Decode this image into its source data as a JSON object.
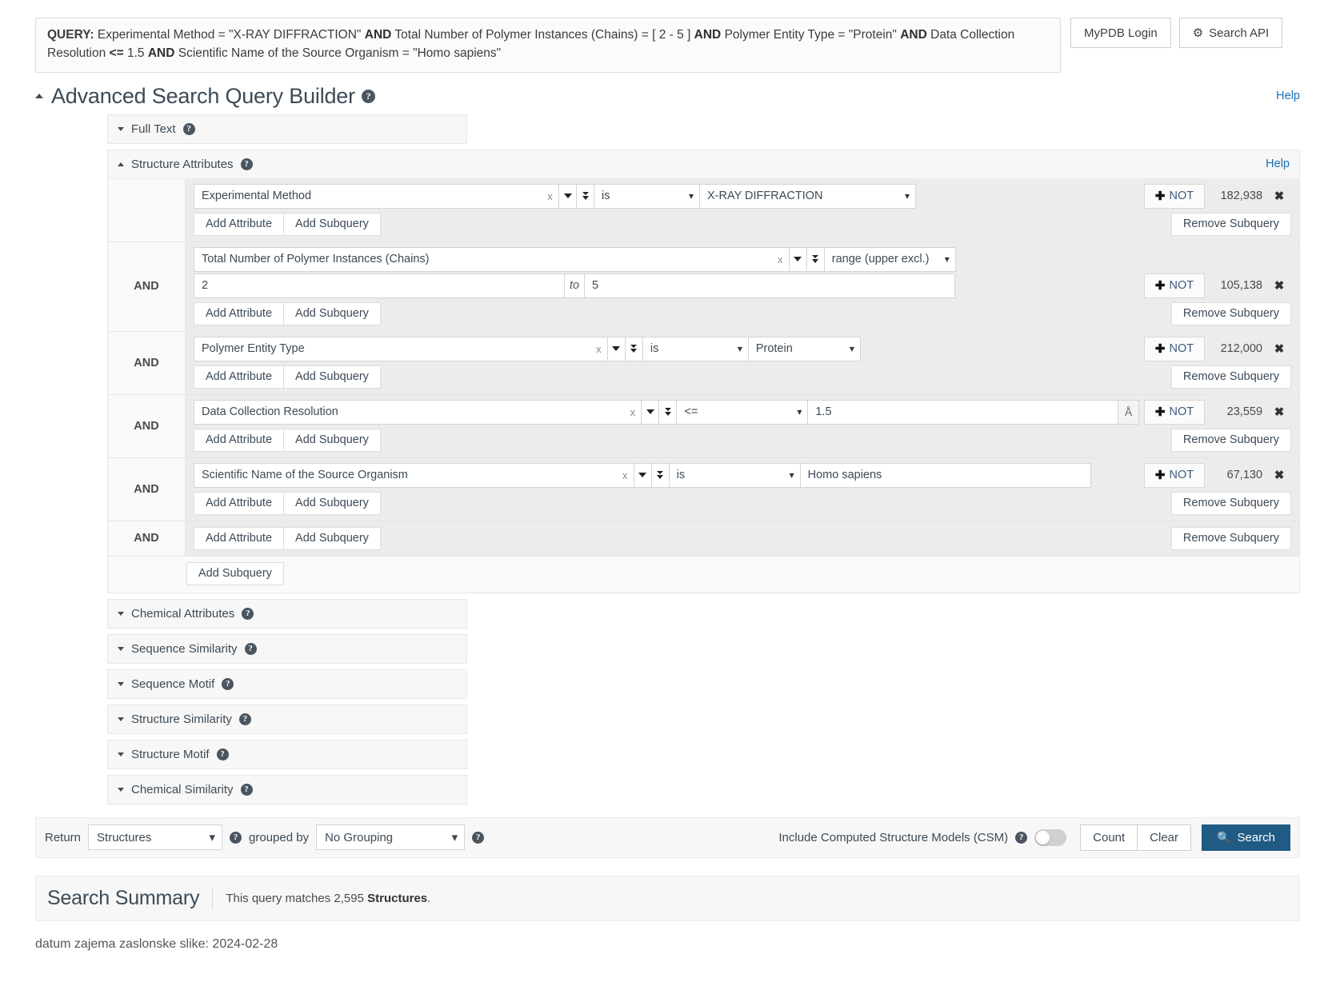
{
  "query_bar": {
    "label": "QUERY:",
    "segments": [
      {
        "text": "Experimental Method = \"X-RAY DIFFRACTION\" ",
        "bold": false
      },
      {
        "text": "AND",
        "bold": true
      },
      {
        "text": " Total Number of Polymer Instances (Chains) = [ 2 - 5 ] ",
        "bold": false
      },
      {
        "text": "AND",
        "bold": true
      },
      {
        "text": " Polymer Entity Type = \"Protein\" ",
        "bold": false
      },
      {
        "text": "AND",
        "bold": true
      },
      {
        "text": " Data Collection Resolution ",
        "bold": false
      },
      {
        "text": "<=",
        "bold": true
      },
      {
        "text": " 1.5 ",
        "bold": false
      },
      {
        "text": "AND",
        "bold": true
      },
      {
        "text": " Scientific Name of the Source Organism = \"Homo sapiens\"",
        "bold": false
      }
    ],
    "mypdb_login": "MyPDB Login",
    "search_api": "Search API",
    "search_api_icon": "gear-icon"
  },
  "builder": {
    "title": "Advanced Search Query Builder",
    "title_help_icon": "question-circle-icon",
    "collapse_icon": "caret-up-icon",
    "help_link": "Help",
    "full_text": {
      "label": "Full Text",
      "help_icon": "question-circle-icon",
      "expand_icon": "caret-down-icon"
    },
    "structure_attributes": {
      "label": "Structure Attributes",
      "help_icon": "question-circle-icon",
      "collapse_icon": "caret-up-icon",
      "help_link": "Help"
    },
    "add_attribute_label": "Add Attribute",
    "add_subquery_label": "Add Subquery",
    "remove_subquery_label": "Remove Subquery",
    "not_label": "NOT",
    "close_label": "✖",
    "clear_label": "x",
    "to_label": "to",
    "logic_operator": "AND",
    "rows": [
      {
        "logic": "",
        "attribute": "Experimental Method",
        "operator": "is",
        "value_type": "select",
        "value": "X-RAY DIFFRACTION",
        "count": "182,938",
        "unit": ""
      },
      {
        "logic": "AND",
        "attribute": "Total Number of Polymer Instances (Chains)",
        "operator": "range (upper excl.)",
        "value_type": "range",
        "value_from": "2",
        "value_to": "5",
        "count": "105,138",
        "unit": ""
      },
      {
        "logic": "AND",
        "attribute": "Polymer Entity Type",
        "operator": "is",
        "value_type": "select-narrow",
        "value": "Protein",
        "count": "212,000",
        "unit": ""
      },
      {
        "logic": "AND",
        "attribute": "Data Collection Resolution",
        "operator": "<=",
        "value_type": "input-unit",
        "value": "1.5",
        "count": "23,559",
        "unit": "Å"
      },
      {
        "logic": "AND",
        "attribute": "Scientific Name of the Source Organism",
        "operator": "is",
        "value_type": "input",
        "value": "Homo sapiens",
        "count": "67,130",
        "unit": ""
      }
    ],
    "trailing_logic": "AND",
    "bottom_add_subquery": "Add Subquery",
    "sections": [
      {
        "label": "Chemical Attributes",
        "help_icon": "question-circle-icon"
      },
      {
        "label": "Sequence Similarity",
        "help_icon": "question-circle-icon"
      },
      {
        "label": "Sequence Motif",
        "help_icon": "question-circle-icon"
      },
      {
        "label": "Structure Similarity",
        "help_icon": "question-circle-icon"
      },
      {
        "label": "Structure Motif",
        "help_icon": "question-circle-icon"
      },
      {
        "label": "Chemical Similarity",
        "help_icon": "question-circle-icon"
      }
    ]
  },
  "controls": {
    "return_label": "Return",
    "return_value": "Structures",
    "return_help_icon": "question-circle-icon",
    "grouped_by_label": "grouped by",
    "grouped_by_value": "No Grouping",
    "grouped_by_help_icon": "question-circle-icon",
    "csm_label": "Include Computed Structure Models (CSM)",
    "csm_help_icon": "question-circle-icon",
    "csm_enabled": false,
    "count_label": "Count",
    "clear_label": "Clear",
    "search_label": "Search",
    "search_icon": "magnifier-icon",
    "search_button_color": "#205b84",
    "search_icon_color": "#21c55d"
  },
  "summary": {
    "heading": "Search Summary",
    "prefix": "This query matches ",
    "count": "2,595",
    "suffix_bold": "Structures",
    "suffix": "."
  },
  "caption": "datum zajema zaslonske slike: 2024-02-28"
}
